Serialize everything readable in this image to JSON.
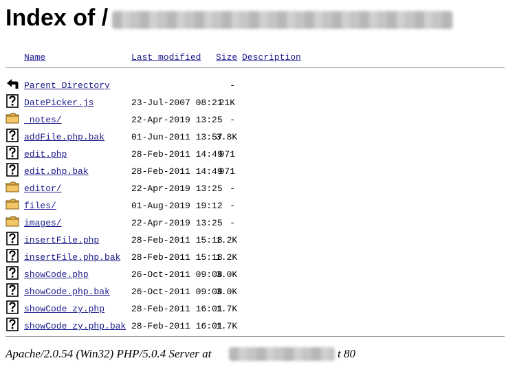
{
  "page": {
    "title": "Index of /",
    "title_redacted": true
  },
  "columns": {
    "name": "Name",
    "last_modified": "Last modified",
    "size": "Size",
    "description": "Description"
  },
  "entries": [
    {
      "icon": "back-icon",
      "name": "Parent Directory",
      "modified": "",
      "size": "-"
    },
    {
      "icon": "unknown-file-icon",
      "name": "DatePicker.js",
      "modified": "23-Jul-2007 08:21",
      "size": "21K"
    },
    {
      "icon": "folder-icon",
      "name": "_notes/",
      "modified": "22-Apr-2019 13:25",
      "size": "-"
    },
    {
      "icon": "unknown-file-icon",
      "name": "addFile.php.bak",
      "modified": "01-Jun-2011 13:57",
      "size": "3.8K"
    },
    {
      "icon": "unknown-file-icon",
      "name": "edit.php",
      "modified": "28-Feb-2011 14:49",
      "size": "971"
    },
    {
      "icon": "unknown-file-icon",
      "name": "edit.php.bak",
      "modified": "28-Feb-2011 14:49",
      "size": "971"
    },
    {
      "icon": "folder-icon",
      "name": "editor/",
      "modified": "22-Apr-2019 13:25",
      "size": "-"
    },
    {
      "icon": "folder-icon",
      "name": "files/",
      "modified": "01-Aug-2019 19:12",
      "size": "-"
    },
    {
      "icon": "folder-icon",
      "name": "images/",
      "modified": "22-Apr-2019 13:25",
      "size": "-"
    },
    {
      "icon": "unknown-file-icon",
      "name": "insertFile.php",
      "modified": "28-Feb-2011 15:18",
      "size": "1.2K"
    },
    {
      "icon": "unknown-file-icon",
      "name": "insertFile.php.bak",
      "modified": "28-Feb-2011 15:18",
      "size": "1.2K"
    },
    {
      "icon": "unknown-file-icon",
      "name": "showCode.php",
      "modified": "26-Oct-2011 09:08",
      "size": "3.0K"
    },
    {
      "icon": "unknown-file-icon",
      "name": "showCode.php.bak",
      "modified": "26-Oct-2011 09:08",
      "size": "3.0K"
    },
    {
      "icon": "unknown-file-icon",
      "name": "showCode_zy.php",
      "modified": "28-Feb-2011 16:01",
      "size": "1.7K"
    },
    {
      "icon": "unknown-file-icon",
      "name": "showCode_zy.php.bak",
      "modified": "28-Feb-2011 16:01",
      "size": "1.7K"
    }
  ],
  "footer": {
    "server_text": "Apache/2.0.54 (Win32) PHP/5.0.4 Server at",
    "port_text": "t 80",
    "host_redacted": true
  },
  "colors": {
    "link": "#1a1a8c",
    "folder": "#e8b24a",
    "rule": "#a0a0a0"
  }
}
